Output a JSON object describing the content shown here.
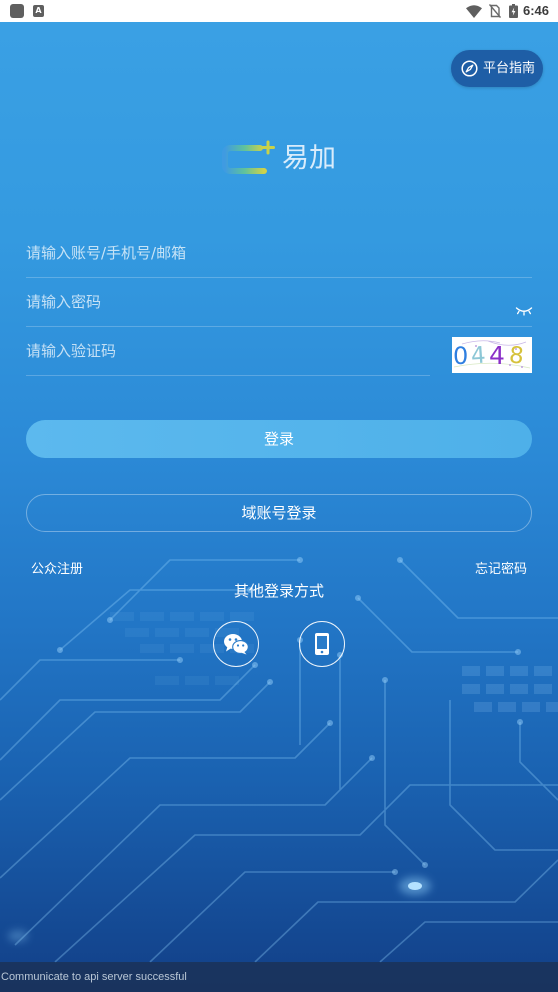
{
  "status_bar": {
    "notification_letter": "A",
    "time": "6:46"
  },
  "guide_button": {
    "label": "平台指南",
    "icon": "compass-icon"
  },
  "logo": {
    "text": "易加",
    "icon": "yijia-logo-icon"
  },
  "form": {
    "account": {
      "placeholder": "请输入账号/手机号/邮箱",
      "value": ""
    },
    "password": {
      "placeholder": "请输入密码",
      "value": "",
      "visibility_icon": "eye-closed-icon"
    },
    "captcha": {
      "placeholder": "请输入验证码",
      "value": "",
      "image_digits": [
        "0",
        "4",
        "4",
        "8"
      ]
    }
  },
  "login_button": {
    "label": "登录"
  },
  "domain_login_button": {
    "label": "域账号登录"
  },
  "links": {
    "register": "公众注册",
    "forgot_password": "忘记密码"
  },
  "other_login": {
    "title": "其他登录方式",
    "methods": [
      {
        "icon": "wechat-icon"
      },
      {
        "icon": "phone-icon"
      }
    ]
  },
  "toast": {
    "message": "Communicate to api server successful"
  },
  "colors": {
    "status_bar_bg": "#ffffff",
    "background_top": "#3aa0e4",
    "background_bottom": "#123f87",
    "login_button": "#55b3ea",
    "guide_button": "#1e5ea6",
    "captcha_digits": [
      "#2f7fe0",
      "#8cc7d6",
      "#8a2fc8",
      "#d6c23c"
    ]
  }
}
